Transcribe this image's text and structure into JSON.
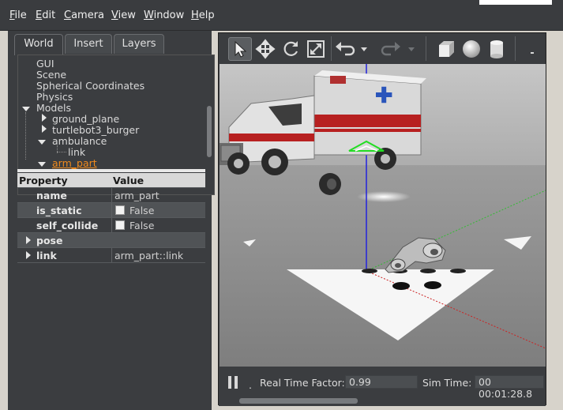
{
  "menu": {
    "items": [
      {
        "key": "F",
        "rest": "ile"
      },
      {
        "key": "E",
        "rest": "dit"
      },
      {
        "key": "C",
        "rest": "amera"
      },
      {
        "key": "V",
        "rest": "iew"
      },
      {
        "key": "W",
        "rest": "indow"
      },
      {
        "key": "H",
        "rest": "elp"
      }
    ]
  },
  "left_panel": {
    "tabs": [
      "World",
      "Insert",
      "Layers"
    ],
    "active_tab": "World",
    "tree": {
      "gui": "GUI",
      "scene": "Scene",
      "spherical": "Spherical Coordinates",
      "physics": "Physics",
      "models": "Models",
      "ground_plane": "ground_plane",
      "turtlebot": "turtlebot3_burger",
      "ambulance": "ambulance",
      "ambulance_link": "link",
      "arm_part": "arm_part"
    },
    "properties": {
      "header_property": "Property",
      "header_value": "Value",
      "rows": [
        {
          "name": "name",
          "value": "arm_part"
        },
        {
          "name": "is_static",
          "value": "False"
        },
        {
          "name": "self_collide",
          "value": "False"
        },
        {
          "name": "pose",
          "value": ""
        },
        {
          "name": "link",
          "value": "arm_part::link"
        }
      ]
    }
  },
  "toolbar": {
    "tools": [
      "select-tool",
      "translate-tool",
      "rotate-tool",
      "scale-tool",
      "undo",
      "undo-history",
      "redo",
      "redo-history",
      "box-shape",
      "sphere-shape",
      "cylinder-shape"
    ],
    "active_tool": "select-tool"
  },
  "status": {
    "rtf_label": "Real Time Factor:",
    "rtf_value": "0.99",
    "sim_label": "Sim Time:",
    "sim_value": "00 00:01:28.8",
    "paused": false
  },
  "colors": {
    "selection": "#f08a1c",
    "x_axis": "#d02020",
    "y_axis": "#20c020",
    "z_axis": "#2020e0"
  }
}
